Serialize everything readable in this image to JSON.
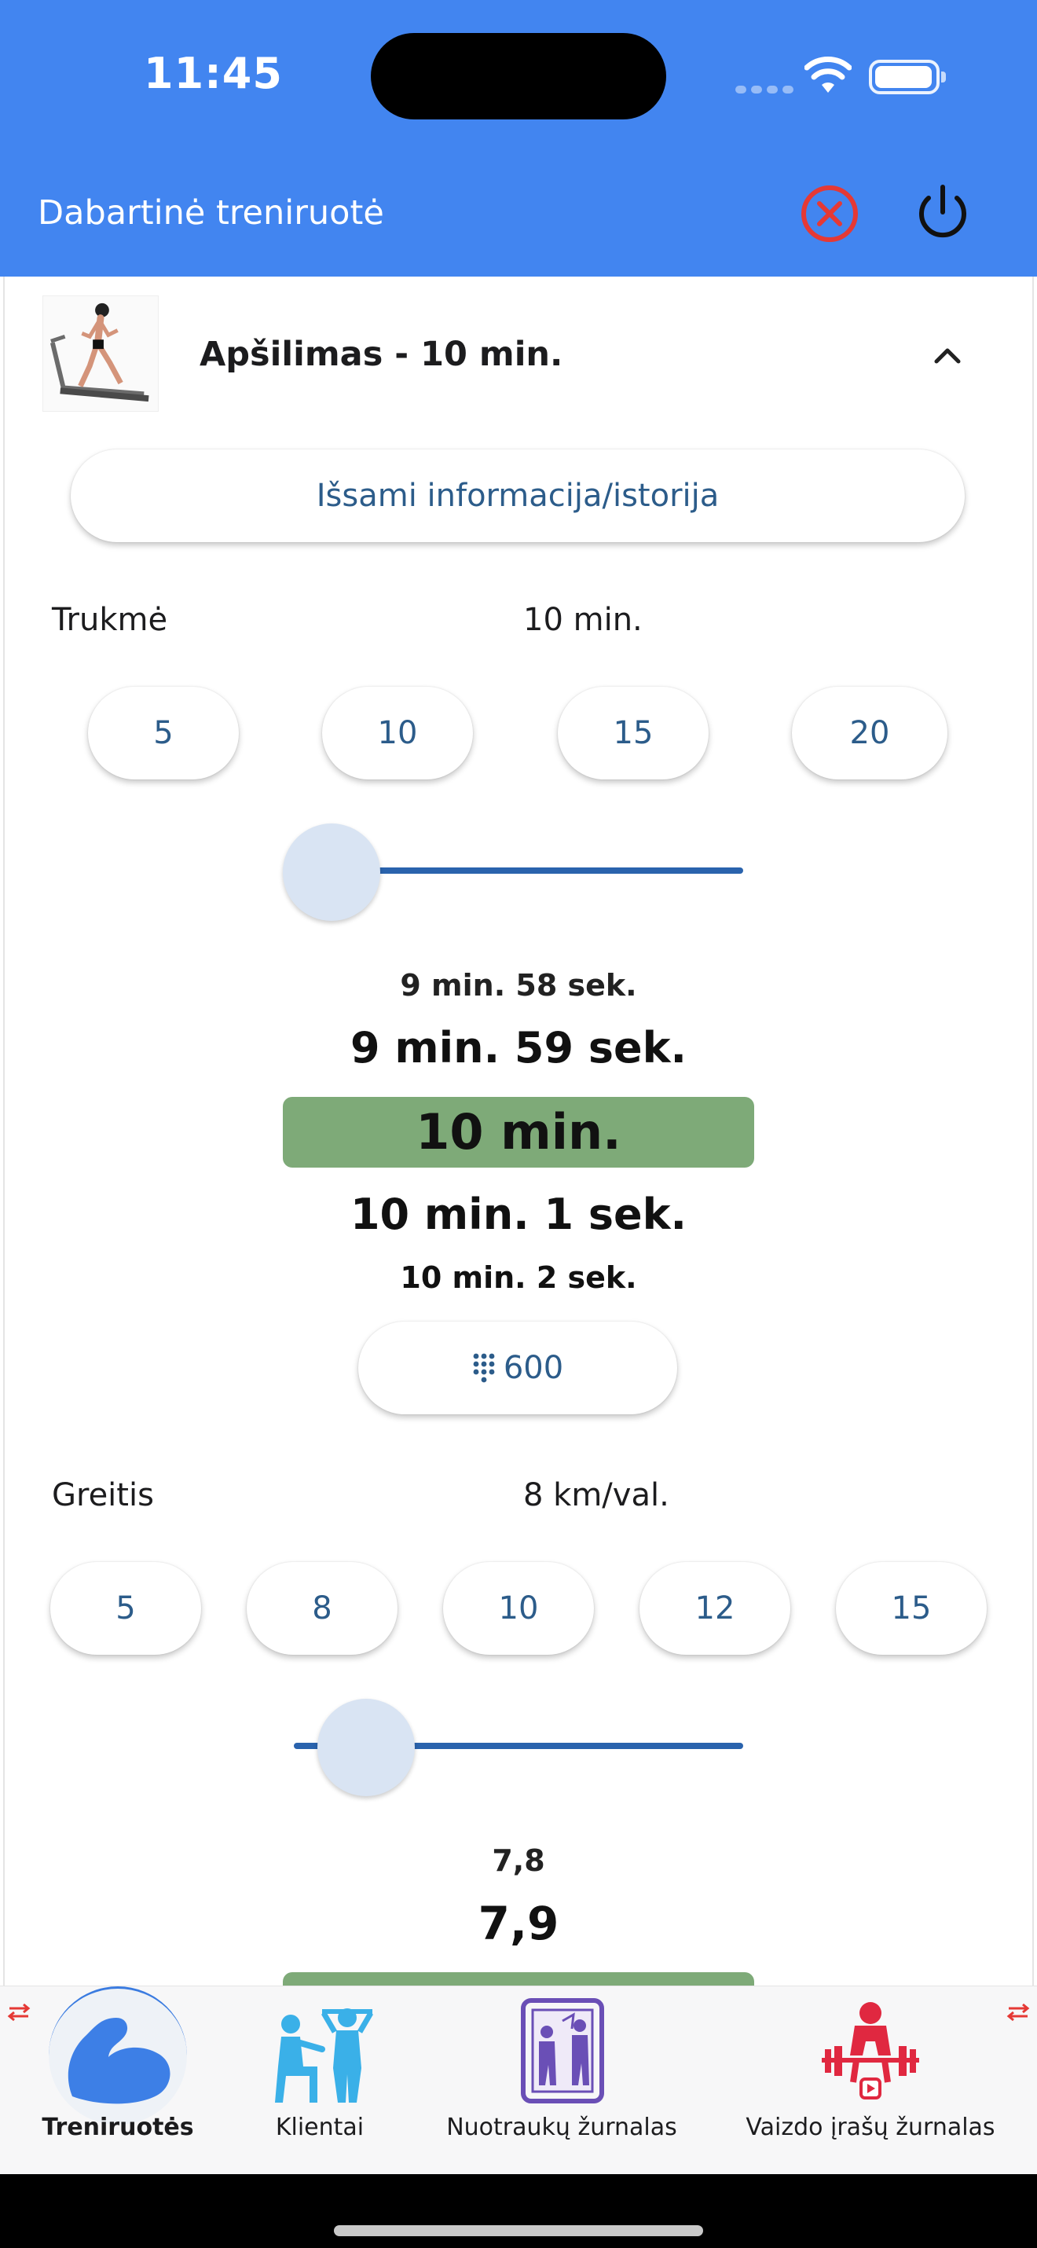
{
  "status_bar": {
    "time": "11:45"
  },
  "app_bar": {
    "title": "Dabartinė treniruotė",
    "cancel_icon": "cancel-circle-icon",
    "power_icon": "power-icon"
  },
  "exercise": {
    "title": "Apšilimas - 10 min.",
    "thumbnail_icon": "treadmill-runner-image",
    "expand_icon": "chevron-up-icon",
    "info_button": "Išsami informacija/istorija"
  },
  "duration": {
    "label": "Trukmė",
    "value": "10 min.",
    "presets": [
      "5",
      "10",
      "15",
      "20"
    ],
    "slider_fraction": 0.0,
    "picker": [
      "9 min. 58 sek.",
      "9 min. 59 sek.",
      "10 min.",
      "10 min. 1 sek.",
      "10 min. 2 sek."
    ],
    "keypad_value": "600"
  },
  "speed": {
    "label": "Greitis",
    "value": "8 km/val.",
    "presets": [
      "5",
      "8",
      "10",
      "12",
      "15"
    ],
    "slider_fraction": 0.16,
    "picker": [
      "7,8",
      "7,9"
    ]
  },
  "bottom_nav": {
    "items": [
      {
        "label": "Treniruotės",
        "icon": "flexed-bicep-icon",
        "active": true
      },
      {
        "label": "Klientai",
        "icon": "trainer-client-icon",
        "active": false
      },
      {
        "label": "Nuotraukų žurnalas",
        "icon": "photo-journal-icon",
        "active": false
      },
      {
        "label": "Vaizdo įrašų žurnalas",
        "icon": "weightlifter-video-icon",
        "active": false
      }
    ]
  },
  "colors": {
    "app_bar": "#4285f0",
    "accent": "#2a63ad",
    "selected": "#7eaa78",
    "cancel": "#e53935"
  }
}
